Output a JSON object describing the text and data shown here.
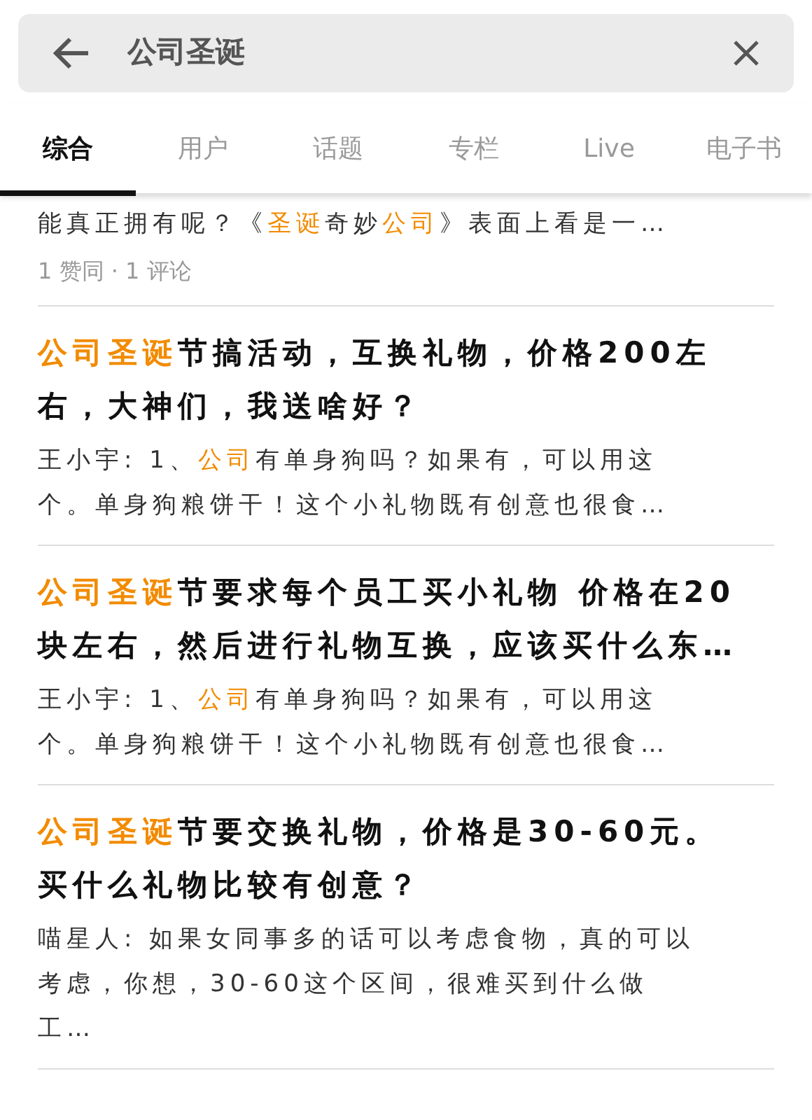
{
  "search": {
    "value": "公司圣诞"
  },
  "tabs": [
    {
      "label": "综合",
      "selected": true
    },
    {
      "label": "用户",
      "selected": false
    },
    {
      "label": "话题",
      "selected": false
    },
    {
      "label": "专栏",
      "selected": false
    },
    {
      "label": "Live",
      "selected": false
    },
    {
      "label": "电子书",
      "selected": false
    }
  ],
  "results": [
    {
      "snippet": [
        {
          "text": "能真正拥有呢？《",
          "highlight": false
        },
        {
          "text": "圣诞",
          "highlight": true
        },
        {
          "text": "奇妙",
          "highlight": false
        },
        {
          "text": "公司",
          "highlight": true
        },
        {
          "text": "》表面上看是一…",
          "highlight": false
        }
      ],
      "meta": "1 赞同 · 1 评论"
    },
    {
      "title": [
        {
          "text": "公司圣诞",
          "highlight": true
        },
        {
          "text": "节搞活动，互换礼物，价格200左右，大神们，我送啥好？",
          "highlight": false
        }
      ],
      "snippet": [
        {
          "text": "王小宇: 1、",
          "highlight": false
        },
        {
          "text": "公司",
          "highlight": true
        },
        {
          "text": "有单身狗吗？如果有，可以用这个。单身狗粮饼干！这个小礼物既有创意也很食…",
          "highlight": false
        }
      ]
    },
    {
      "title": [
        {
          "text": "公司圣诞",
          "highlight": true
        },
        {
          "text": "节要求每个员工买小礼物 价格在20块左右，然后进行礼物互换，应该买什么东…",
          "highlight": false
        }
      ],
      "snippet": [
        {
          "text": "王小宇: 1、",
          "highlight": false
        },
        {
          "text": "公司",
          "highlight": true
        },
        {
          "text": "有单身狗吗？如果有，可以用这个。单身狗粮饼干！这个小礼物既有创意也很食…",
          "highlight": false
        }
      ]
    },
    {
      "title": [
        {
          "text": "公司圣诞",
          "highlight": true
        },
        {
          "text": "节要交换礼物，价格是30-60元。买什么礼物比较有创意？",
          "highlight": false
        }
      ],
      "snippet": [
        {
          "text": "喵星人: 如果女同事多的话可以考虑食物，真的可以考虑，你想，30-60这个区间，很难买到什么做工…",
          "highlight": false
        }
      ]
    }
  ]
}
